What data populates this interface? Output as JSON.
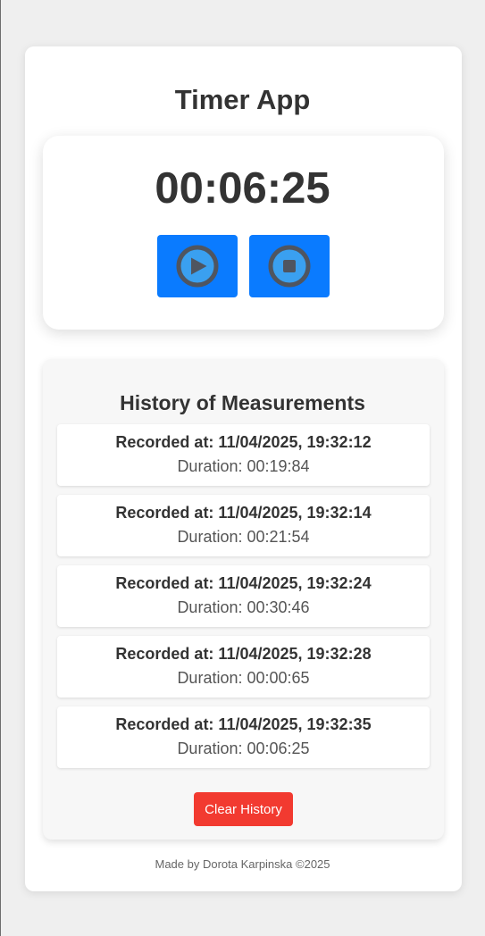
{
  "app": {
    "title": "Timer App"
  },
  "timer": {
    "display": "00:06:25",
    "start_icon": "play-circle-icon",
    "stop_icon": "stop-circle-icon"
  },
  "history": {
    "title": "History of Measurements",
    "items": [
      {
        "recorded": "Recorded at: 11/04/2025, 19:32:12",
        "duration": "Duration: 00:19:84"
      },
      {
        "recorded": "Recorded at: 11/04/2025, 19:32:14",
        "duration": "Duration: 00:21:54"
      },
      {
        "recorded": "Recorded at: 11/04/2025, 19:32:24",
        "duration": "Duration: 00:30:46"
      },
      {
        "recorded": "Recorded at: 11/04/2025, 19:32:28",
        "duration": "Duration: 00:00:65"
      },
      {
        "recorded": "Recorded at: 11/04/2025, 19:32:35",
        "duration": "Duration: 00:06:25"
      }
    ],
    "clear_label": "Clear History"
  },
  "footer": {
    "text": "Made by Dorota Karpinska ©2025"
  },
  "colors": {
    "page_background": "#efefef",
    "button_primary": "#0a7bff",
    "button_danger": "#f23a30",
    "icon_ring": "#4f5560",
    "icon_fill": "#3aa0f0",
    "text_dark": "#333333"
  }
}
